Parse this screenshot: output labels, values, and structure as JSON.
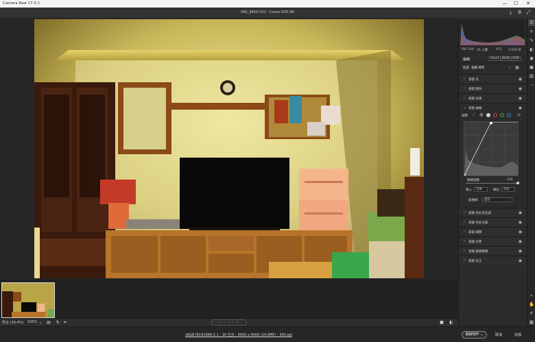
{
  "os_window": {
    "title": "Camera Raw 17.0.1",
    "minimize_glyph": "—",
    "maximize_glyph": "☐",
    "close_glyph": "✕"
  },
  "document": {
    "title": "IMG_8834.CR3  -  Canon EOS R8"
  },
  "header_icons": [
    "save-icon",
    "settings-icon",
    "fullscreen-icon"
  ],
  "histogram": {
    "note_color_shadow": "#2a6fd0"
  },
  "camera_info": {
    "iso": "ISO 100",
    "focal": "35 公釐",
    "aperture": "f/11",
    "shutter": "1/100 秒"
  },
  "panel": {
    "basic_label": "編輯",
    "reset_label": "Reset",
    "bw_label": "B&W",
    "hdr_label": "HDR",
    "profile_label": "配置",
    "profile_value": "相機 標準",
    "sections": [
      {
        "label": "基礎 光",
        "expanded": false
      },
      {
        "label": "基礎 顏色",
        "expanded": false
      },
      {
        "label": "基礎 效果",
        "expanded": false
      },
      {
        "label": "基礎 曲線",
        "expanded": true
      }
    ],
    "curve": {
      "adjust_label": "調整",
      "channel_colors": [
        "#d0d0d0",
        "#d83b3b",
        "#3bb34b",
        "#3b7ed8"
      ],
      "refine_label": "精細調整",
      "refine_value": "100",
      "input_label": "輸入",
      "input_value": "128",
      "output_label": "輸出",
      "output_value": "255",
      "mode_label": "點曲線",
      "mode_value": "自訂"
    },
    "sections_after": [
      {
        "label": "基礎 色彩混合器"
      },
      {
        "label": "基礎 色彩分級"
      },
      {
        "label": "基礎 細節"
      },
      {
        "label": "基礎 光學"
      },
      {
        "label": "基礎 鏡頭模糊"
      },
      {
        "label": "基礎 校正"
      }
    ]
  },
  "bottom_toolbar": {
    "fit_label": "符合 (26.4%)",
    "zoom_value": "100%",
    "stars": "☆☆☆☆☆"
  },
  "status": {
    "file_info": "sRGB IEC61966-2.1 - 16 位元 - 6000 x 4000 (24.0MP) - 300 ppi",
    "open_label": "開啟物件",
    "cancel_label": "取消",
    "done_label": "完成"
  },
  "tools": [
    "edit-icon",
    "crop-icon",
    "heal-icon",
    "mask-icon",
    "redeye-icon",
    "presets-icon",
    "snapshot-icon",
    "more-icon",
    "zoom-icon",
    "hand-icon",
    "sampler-icon",
    "grid-icon"
  ]
}
